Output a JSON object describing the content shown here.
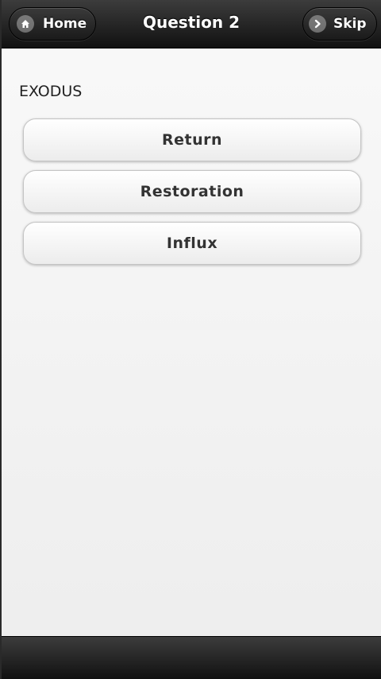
{
  "header": {
    "title": "Question 2",
    "home_label": "Home",
    "skip_label": "Skip"
  },
  "question": {
    "word": "EXODUS"
  },
  "answers": [
    {
      "label": "Return"
    },
    {
      "label": "Restoration"
    },
    {
      "label": "Influx"
    }
  ],
  "icons": {
    "home": "home-icon",
    "skip": "chevron-right-icon"
  }
}
